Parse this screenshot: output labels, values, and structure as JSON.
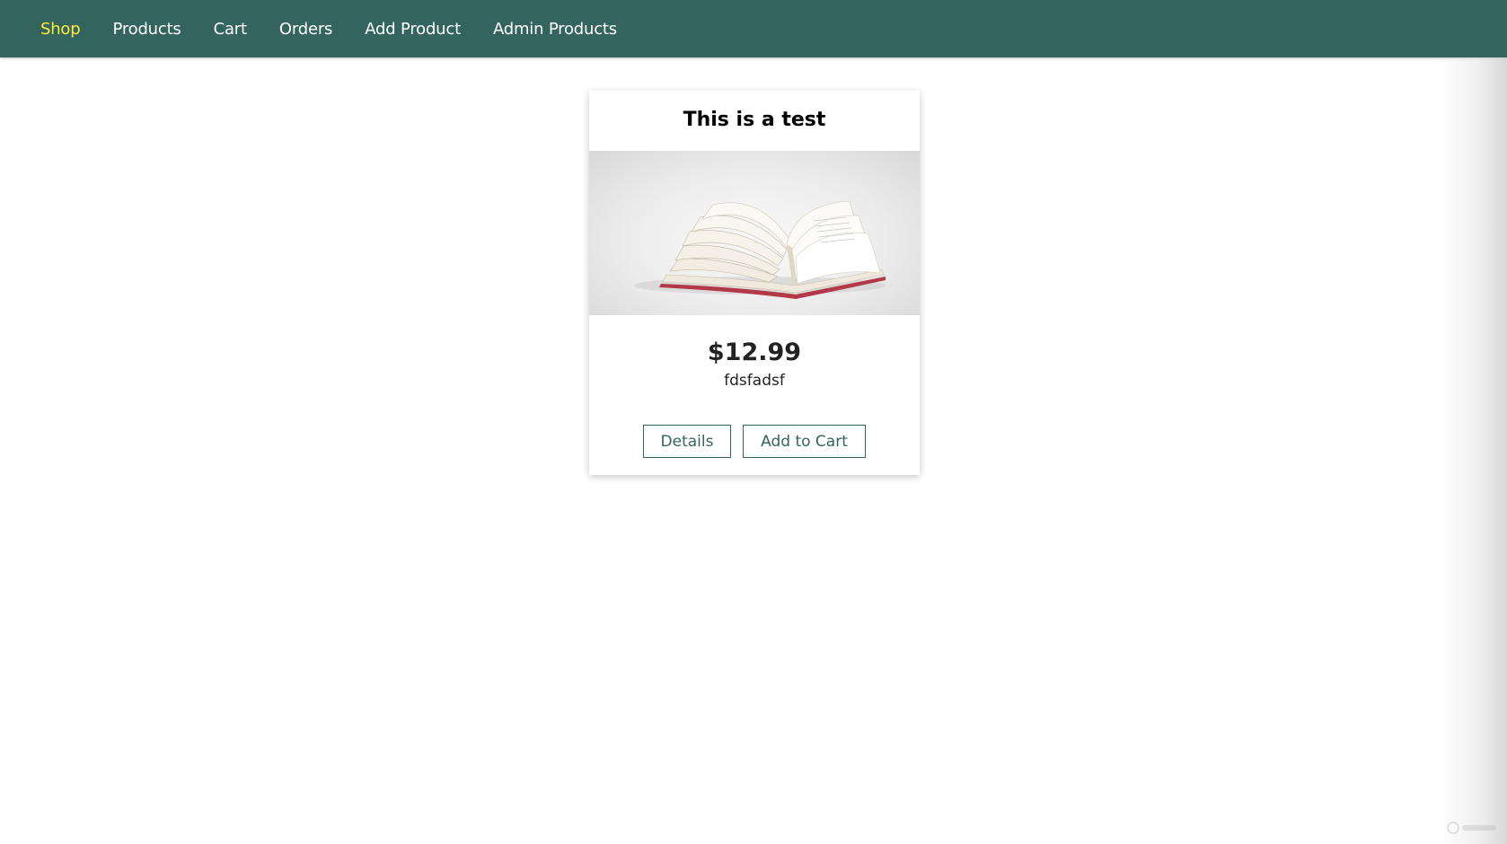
{
  "nav": {
    "items": [
      {
        "label": "Shop",
        "active": true
      },
      {
        "label": "Products",
        "active": false
      },
      {
        "label": "Cart",
        "active": false
      },
      {
        "label": "Orders",
        "active": false
      },
      {
        "label": "Add Product",
        "active": false
      },
      {
        "label": "Admin Products",
        "active": false
      }
    ]
  },
  "product": {
    "title": "This is a test",
    "price": "$12.99",
    "description": "fdsfadsf",
    "image_subject": "open-book",
    "details_label": "Details",
    "add_to_cart_label": "Add to Cart"
  },
  "colors": {
    "header_bg": "#33655e",
    "nav_text": "#ffffff",
    "nav_active": "#ffeb3b",
    "button_border": "#33655e"
  }
}
